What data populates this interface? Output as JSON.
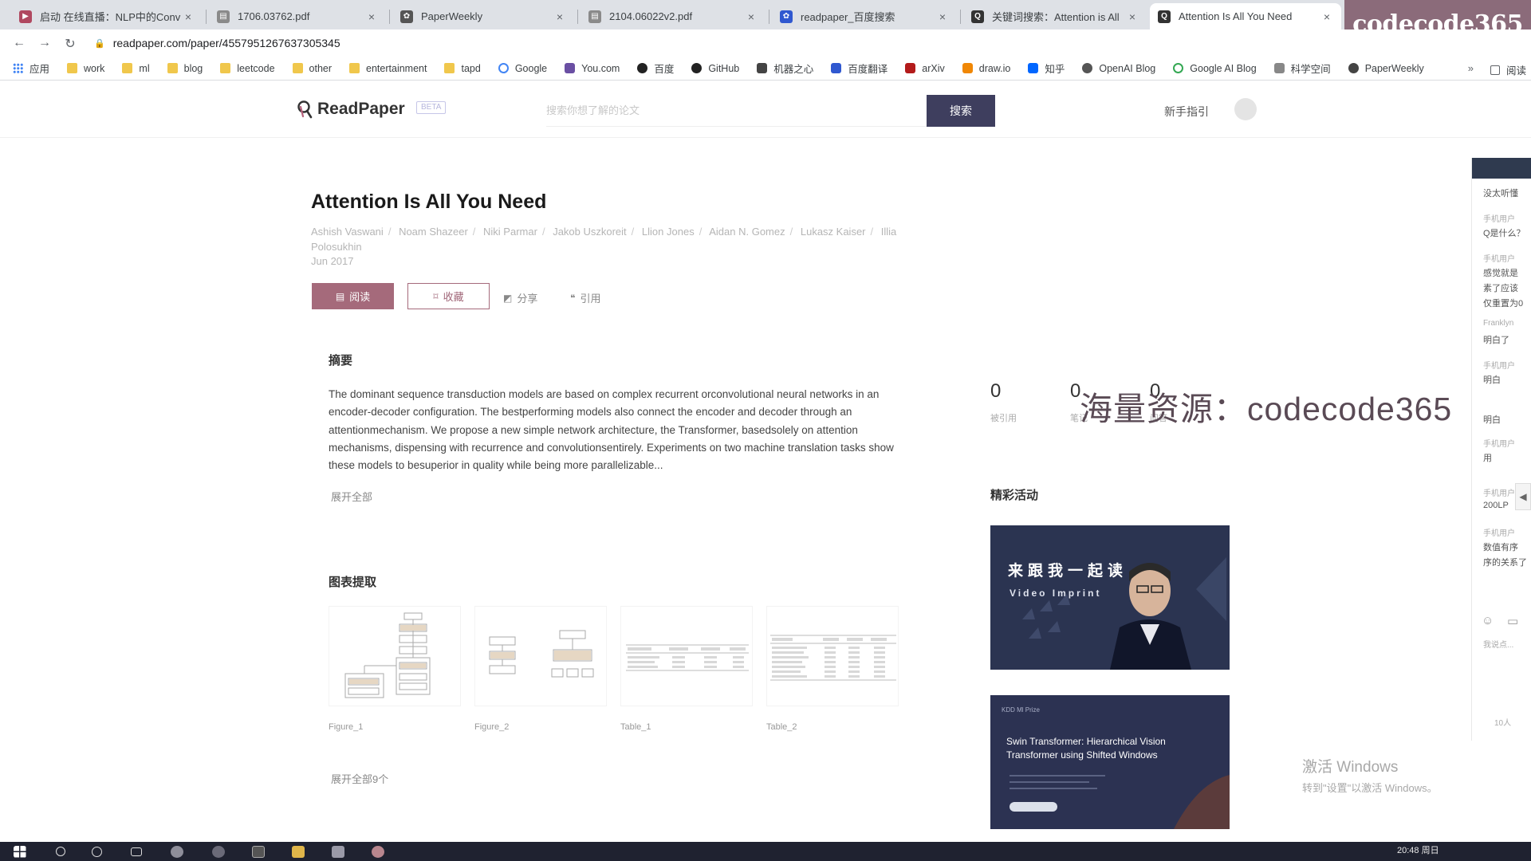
{
  "browser": {
    "tabs": [
      {
        "title": "启动 在线直播：NLP中的Conv",
        "color": "#b04860"
      },
      {
        "title": "1706.03762.pdf",
        "color": "#8a8a8a"
      },
      {
        "title": "PaperWeekly",
        "color": "#555555"
      },
      {
        "title": "2104.06022v2.pdf",
        "color": "#8a8a8a"
      },
      {
        "title": "readpaper_百度搜索",
        "color": "#3058d0"
      },
      {
        "title": "关键词搜索：Attention is All",
        "color": "#333333"
      },
      {
        "title": "Attention Is All You Need",
        "color": "#333333"
      }
    ],
    "tab_close": "×",
    "watermark": "codecode365",
    "back": "←",
    "forward": "→",
    "reload": "↻",
    "lock": "🔒",
    "url": "readpaper.com/paper/4557951267637305345",
    "bookmarks": [
      "应用",
      "work",
      "ml",
      "blog",
      "leetcode",
      "other",
      "entertainment",
      "tapd",
      "Google",
      "You.com",
      "百度",
      "GitHub",
      "机器之心",
      "百度翻译",
      "arXiv",
      "draw.io",
      "知乎",
      "OpenAI Blog",
      "Google AI Blog",
      "科学空间",
      "PaperWeekly"
    ],
    "bookmarks_more": "»",
    "reading_list": "阅读"
  },
  "header": {
    "logo": "ReadPaper",
    "beta": "BETA",
    "search_placeholder": "搜索你想了解的论文",
    "search_button": "搜索",
    "guide": "新手指引"
  },
  "paper": {
    "title": "Attention Is All You Need",
    "authors": [
      "Ashish Vaswani",
      "Noam Shazeer",
      "Niki Parmar",
      "Jakob Uszkoreit",
      "Llion Jones",
      "Aidan N. Gomez",
      "Lukasz Kaiser",
      "Illia Polosukhin"
    ],
    "date": "Jun 2017",
    "actions": {
      "read": "阅读",
      "collect": "收藏",
      "share": "分享",
      "cite": "引用"
    }
  },
  "abstract": {
    "heading": "摘要",
    "text": "The dominant sequence transduction models are based on complex recurrent orconvolutional neural networks in an encoder-decoder configuration. The bestperforming models also connect the encoder and decoder through an attentionmechanism. We propose a new simple network architecture, the Transformer, basedsolely on attention mechanisms, dispensing with recurrence and convolutionsentirely. Experiments on two machine translation tasks show these models to besuperior in quality while being more parallelizable...",
    "expand": "展开全部"
  },
  "figures": {
    "heading": "图表提取",
    "items": [
      "Figure_1",
      "Figure_2",
      "Table_1",
      "Table_2"
    ],
    "expand": "展开全部9个"
  },
  "stats": [
    {
      "value": "0",
      "label": "被引用"
    },
    {
      "value": "0",
      "label": "笔记"
    },
    {
      "value": "0",
      "label": "问答"
    }
  ],
  "overlay": "海量资源：codecode365",
  "events": {
    "heading": "精彩活动",
    "banner1_title": "来跟我一起读",
    "banner1_sub": "Video Imprint",
    "banner2_top": "KDD Ml Prize",
    "banner2_title": "Swin Transformer: Hierarchical Vision Transformer using Shifted Windows"
  },
  "side_panel": {
    "rows": [
      {
        "text": "没太听懂",
        "dim": false
      },
      {
        "text": "手机用户",
        "dim": true
      },
      {
        "text": "Q是什么？",
        "dim": false
      },
      {
        "text": "手机用户",
        "dim": true
      },
      {
        "text": "感觉就是",
        "dim": false
      },
      {
        "text": "素了应该",
        "dim": false
      },
      {
        "text": "仅重置为0",
        "dim": false
      },
      {
        "text": "Franklyn",
        "dim": true
      },
      {
        "text": "明白了",
        "dim": false
      },
      {
        "text": "手机用户",
        "dim": true
      },
      {
        "text": "明白",
        "dim": false
      },
      {
        "text": "明白",
        "dim": false
      },
      {
        "text": "手机用户",
        "dim": true
      },
      {
        "text": "用",
        "dim": false
      },
      {
        "text": "手机用户",
        "dim": true
      },
      {
        "text": "200LP",
        "dim": false
      },
      {
        "text": "手机用户",
        "dim": true
      },
      {
        "text": "数值有序",
        "dim": false
      },
      {
        "text": "序的关系了",
        "dim": false
      }
    ],
    "footer_hint": "我说点...",
    "count": "10人",
    "arrow": "◀"
  },
  "windows": {
    "activate_title": "激活 Windows",
    "activate_sub": "转到\"设置\"以激活 Windows。",
    "clock": "20:48 周日"
  }
}
